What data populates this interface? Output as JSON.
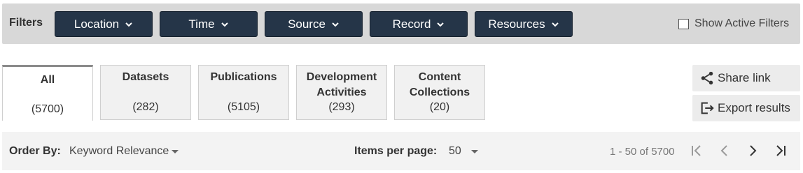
{
  "filters": {
    "label": "Filters",
    "buttons": [
      {
        "label": "Location"
      },
      {
        "label": "Time"
      },
      {
        "label": "Source"
      },
      {
        "label": "Record"
      },
      {
        "label": "Resources"
      }
    ],
    "show_active_label": "Show Active Filters",
    "show_active_checked": false
  },
  "tabs": [
    {
      "label": "All",
      "count": "(5700)",
      "active": true
    },
    {
      "label": "Datasets",
      "count": "(282)"
    },
    {
      "label": "Publications",
      "count": "(5105)"
    },
    {
      "label_line1": "Development",
      "label_line2": "Activities",
      "count": "(293)"
    },
    {
      "label_line1": "Content",
      "label_line2": "Collections",
      "count": "(20)"
    }
  ],
  "actions": {
    "share_label": "Share link",
    "export_label": "Export results"
  },
  "results_bar": {
    "order_by_label": "Order By:",
    "order_by_value": "Keyword Relevance",
    "items_per_page_label": "Items per page:",
    "items_per_page_value": "50",
    "range_text": "1 - 50 of 5700"
  },
  "icons": {
    "dropdown": "chevron-down-icon",
    "share": "share-icon",
    "export": "export-icon",
    "first": "first-page-icon",
    "prev": "previous-page-icon",
    "next": "next-page-icon",
    "last": "last-page-icon"
  },
  "colors": {
    "filter_button_bg": "#253548",
    "filter_bar_bg": "#d8d8d8",
    "tab_bg": "#f1f1f1",
    "results_bar_bg": "#f3f3f3"
  }
}
